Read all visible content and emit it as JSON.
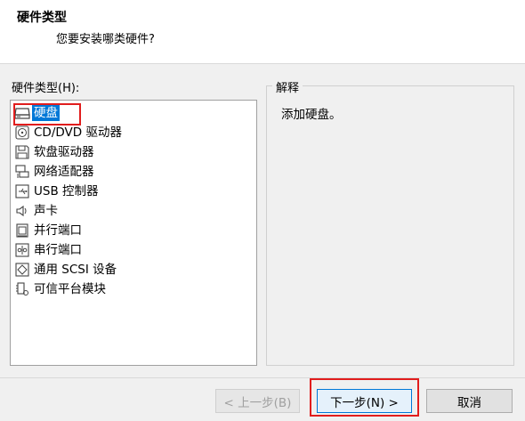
{
  "header": {
    "title": "硬件类型",
    "subtitle": "您要安装哪类硬件?"
  },
  "hardware_list": {
    "label": "硬件类型(H):",
    "selected": "硬盘",
    "items": [
      {
        "label": "硬盘",
        "icon": "hard-disk-icon"
      },
      {
        "label": "CD/DVD 驱动器",
        "icon": "cd-dvd-icon"
      },
      {
        "label": "软盘驱动器",
        "icon": "floppy-icon"
      },
      {
        "label": "网络适配器",
        "icon": "network-adapter-icon"
      },
      {
        "label": "USB 控制器",
        "icon": "usb-icon"
      },
      {
        "label": "声卡",
        "icon": "sound-card-icon"
      },
      {
        "label": "并行端口",
        "icon": "parallel-port-icon"
      },
      {
        "label": "串行端口",
        "icon": "serial-port-icon"
      },
      {
        "label": "通用 SCSI 设备",
        "icon": "scsi-device-icon"
      },
      {
        "label": "可信平台模块",
        "icon": "tpm-icon"
      }
    ]
  },
  "description": {
    "legend": "解释",
    "text": "添加硬盘。"
  },
  "footer": {
    "back_label": "< 上一步(B)",
    "next_label": "下一步(N) >",
    "cancel_label": "取消"
  },
  "colors": {
    "selection": "#0078d7",
    "highlight": "#e11d1d"
  }
}
